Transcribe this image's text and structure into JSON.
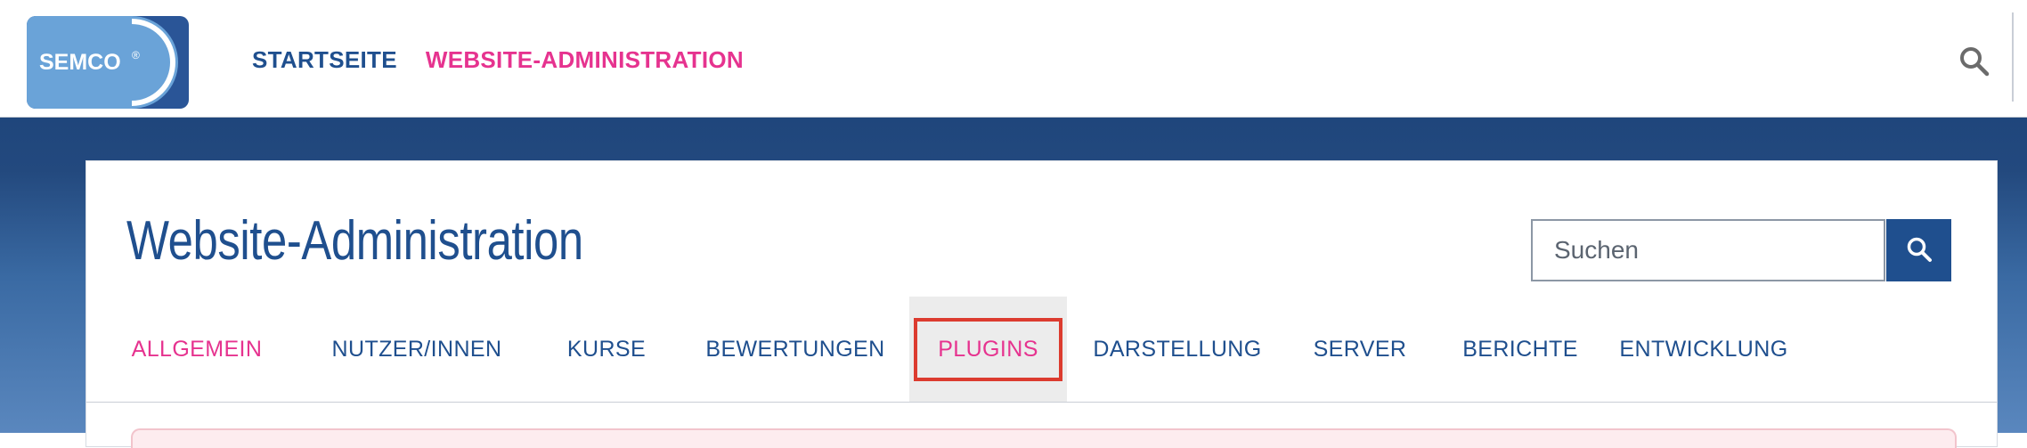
{
  "logo": {
    "text": "SEMCO",
    "mark": "®",
    "colors": {
      "light": "#6aa3d8",
      "dark": "#2a5597"
    }
  },
  "topnav": {
    "items": [
      {
        "label": "STARTSEITE",
        "color": "#1f4f8e"
      },
      {
        "label": "WEBSITE-ADMINISTRATION",
        "color": "#e6338f"
      }
    ]
  },
  "header_search_icon": "search-icon",
  "page": {
    "title": "Website-Administration",
    "search": {
      "placeholder": "Suchen",
      "button_icon": "search-icon"
    }
  },
  "tabs": [
    {
      "label": "ALLGEMEIN",
      "state": "current"
    },
    {
      "label": "NUTZER/INNEN"
    },
    {
      "label": "KURSE"
    },
    {
      "label": "BEWERTUNGEN"
    },
    {
      "label": "PLUGINS",
      "state": "highlighted"
    },
    {
      "label": "DARSTELLUNG"
    },
    {
      "label": "SERVER"
    },
    {
      "label": "BERICHTE"
    },
    {
      "label": "ENTWICKLUNG"
    }
  ],
  "colors": {
    "brand_blue": "#1f4f8e",
    "accent_pink": "#e6338f",
    "highlight_red": "#dc3b2f"
  }
}
